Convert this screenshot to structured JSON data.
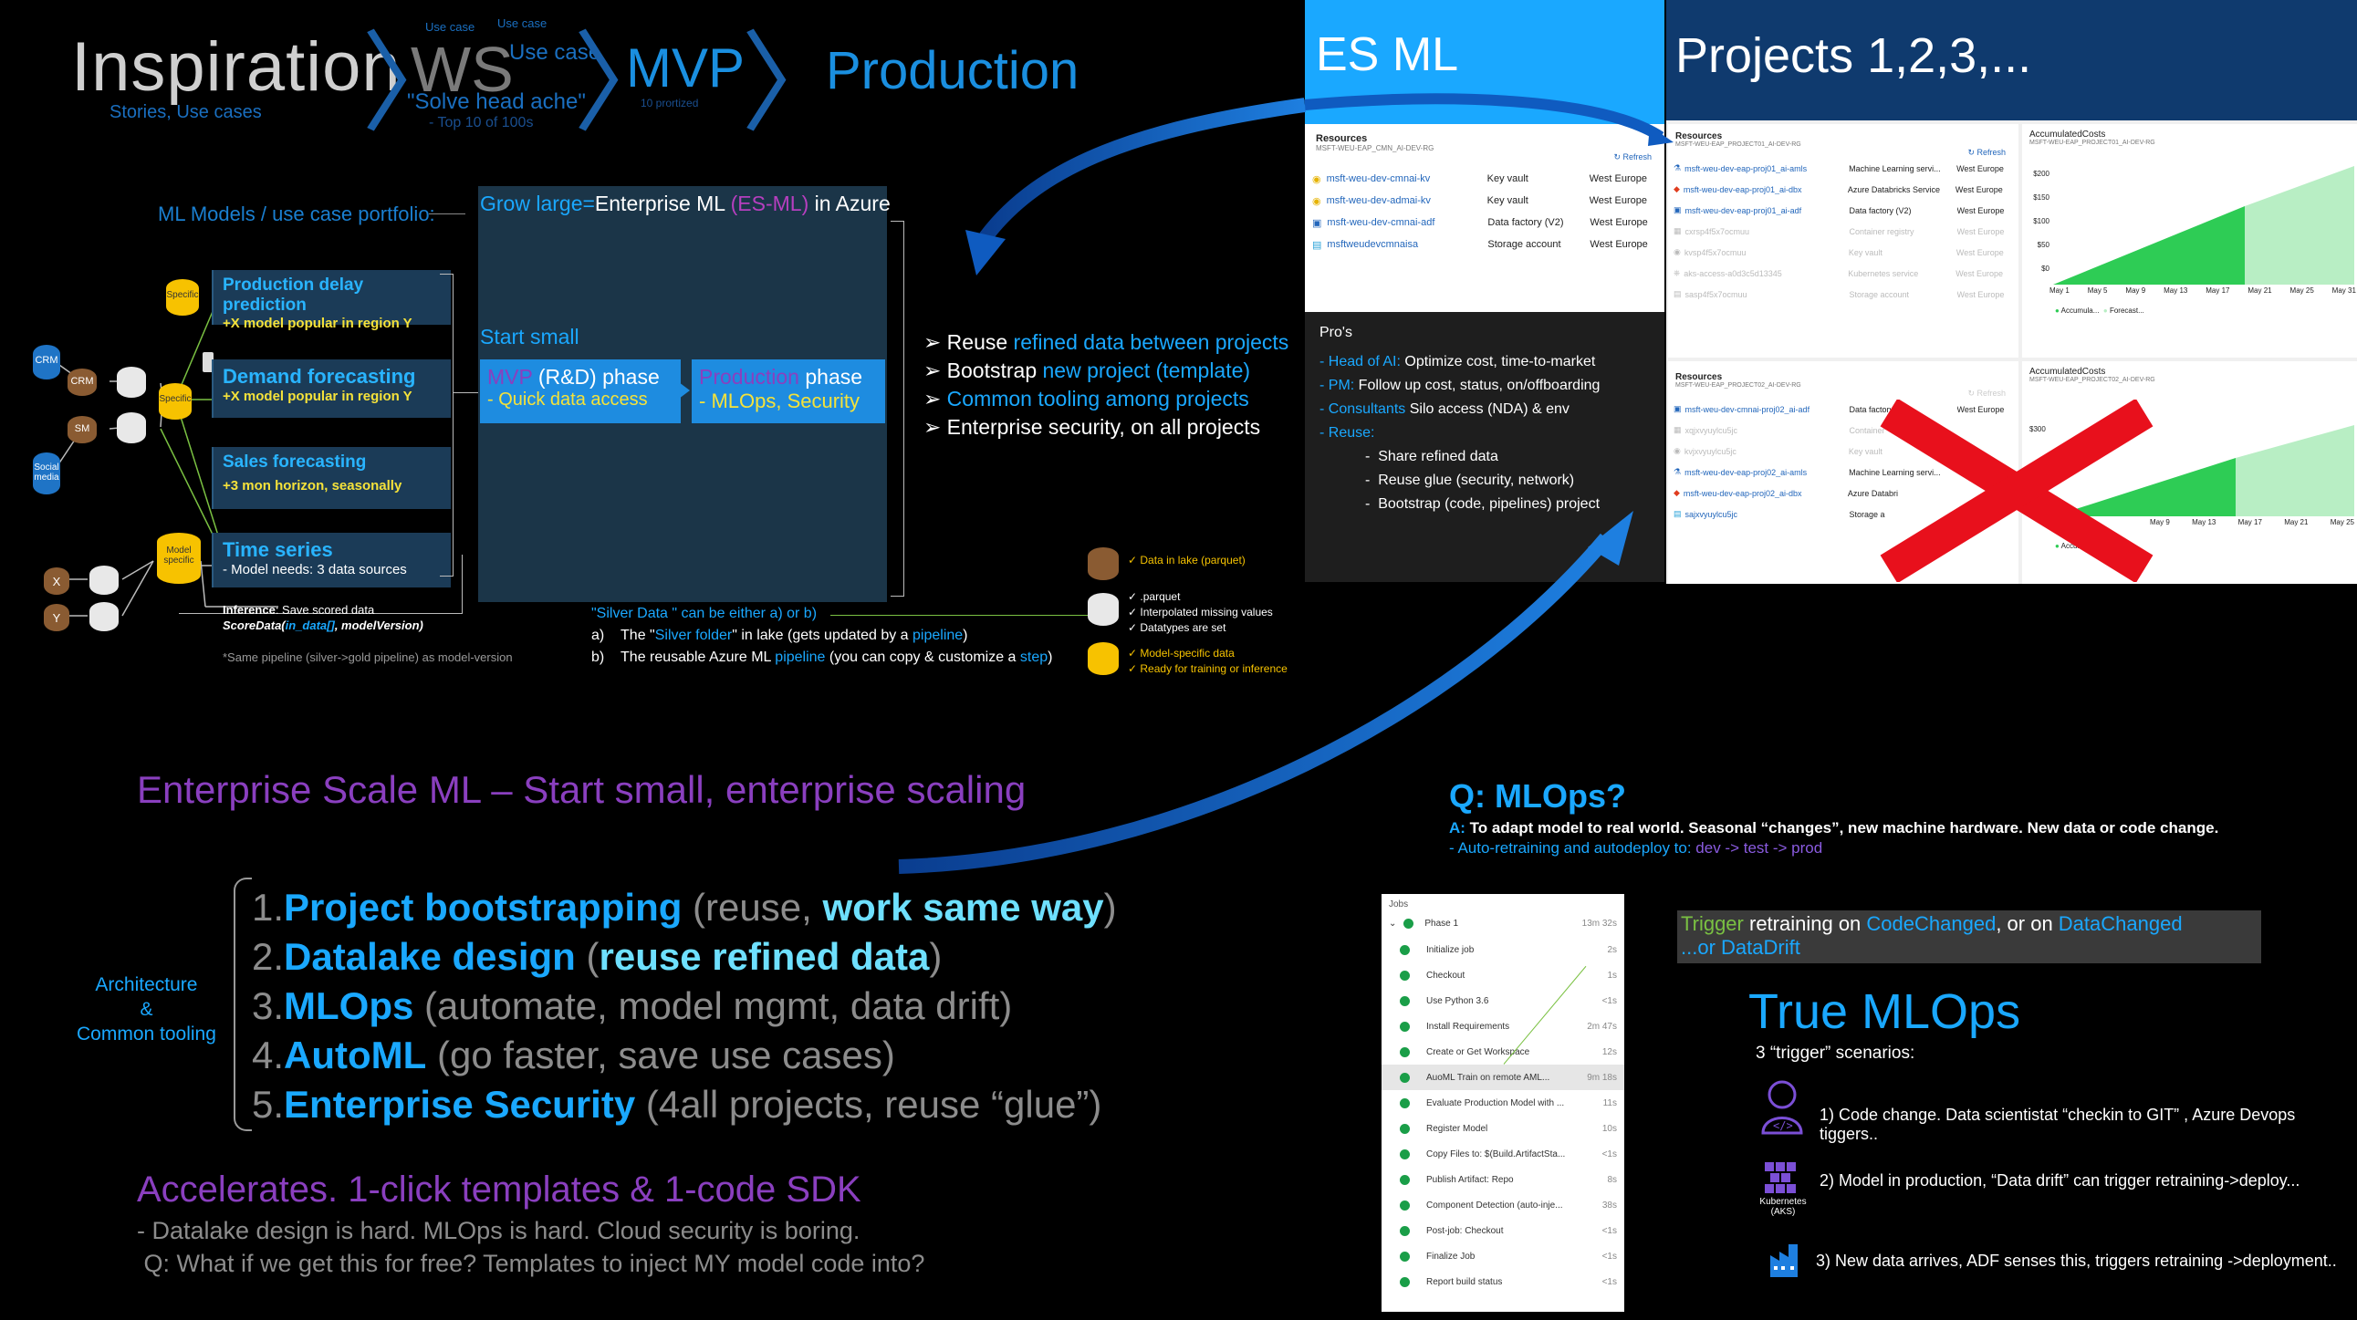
{
  "header": {
    "inspiration": "Inspiration",
    "inspiration_sub": "Stories, Use cases",
    "ws": "WS",
    "ws_usecase_small": "Use case",
    "ws_usecase_small2": "Use case",
    "ws_usecase": "Use case",
    "ws_quote": "\"Solve head ache\"",
    "ws_top": "- Top 10 of 100s",
    "mvp": "MVP",
    "mvp_sub": "10 prortized",
    "production": "Production"
  },
  "left_diagram": {
    "portfolio_title": "ML Models / use case portfolio:",
    "sources": [
      "CRM",
      "SM",
      "Social media",
      "X",
      "Y"
    ],
    "node_crm": "CRM",
    "node_sm": "SM",
    "specific": "Specific",
    "model_specific": "Model specific",
    "models": [
      {
        "title": "Production delay prediction",
        "sub": "+X model popular in region Y"
      },
      {
        "title": "Demand forecasting",
        "sub": "+X model popular in region Y"
      },
      {
        "title": "Sales forecasting",
        "sub": "+3 mon horizon, seasonally"
      },
      {
        "title": "Time series",
        "sub": "- Model needs: 3 data sources"
      }
    ],
    "inference_label": "Inference",
    "inference_text": ": Save scored data",
    "score_fn": "ScoreData(",
    "score_arg1": "in_data[]",
    "score_arg2": ", modelVersion)",
    "same_pipeline": "*Same pipeline (silver->gold pipeline) as model-version"
  },
  "center_box": {
    "grow_prefix": "Grow large=",
    "grow_mid": "Enterprise ML ",
    "grow_esml": "(ES-ML)",
    "grow_suffix": " in Azure",
    "start_small": "Start small",
    "mvp_phase_a": "MVP",
    "mvp_phase_b": " (R&D) phase",
    "mvp_sub": "- Quick data access",
    "prod_phase_a": "Production",
    "prod_phase_b": " phase",
    "prod_sub_a": "- MLOps, ",
    "prod_sub_b": "Security"
  },
  "bullets": [
    {
      "a": "Reuse ",
      "b": "refined data",
      "c": " between projects"
    },
    {
      "a": "Bootstrap ",
      "b": "new project (template)",
      "c": ""
    },
    {
      "a": "",
      "b": "Common tooling among projects",
      "c": ""
    },
    {
      "a": "Enterprise security, on all projects",
      "b": "",
      "c": ""
    }
  ],
  "silver": {
    "title": "\"Silver Data \" can be either a) or b)",
    "a_label": "a)",
    "a_text1": "The \"",
    "a_link": "Silver folder",
    "a_text2": "\" in lake (gets updated by a ",
    "a_link2": "pipeline",
    "a_text3": ")",
    "b_label": "b)",
    "b_text1": "The reusable Azure ML ",
    "b_link": "pipeline",
    "b_text2": " (you can copy & customize a ",
    "b_link2": "step",
    "b_text3": ")"
  },
  "legend": {
    "brown": "Data in lake (parquet)",
    "white": [
      ".parquet",
      "Interpolated missing values",
      "Datatypes are set"
    ],
    "yellow": [
      "Model-specific data",
      "Ready for training or inference"
    ]
  },
  "esml_panel": {
    "title": "ES ML",
    "resources_title": "Resources",
    "resources_sub": "MSFT-WEU-EAP_CMN_AI-DEV-RG",
    "refresh": "Refresh",
    "rows": [
      {
        "name": "msft-weu-dev-cmnai-kv",
        "type": "Key vault",
        "loc": "West Europe"
      },
      {
        "name": "msft-weu-dev-admai-kv",
        "type": "Key vault",
        "loc": "West Europe"
      },
      {
        "name": "msft-weu-dev-cmnai-adf",
        "type": "Data factory (V2)",
        "loc": "West Europe"
      },
      {
        "name": "msftweudevcmnaisa",
        "type": "Storage account",
        "loc": "West Europe"
      }
    ],
    "pros_title": "Pro's",
    "pros": [
      {
        "label": "Head of AI:",
        "text": " Optimize cost, time-to-market"
      },
      {
        "label": "PM:",
        "text": " Follow up cost, status, on/offboarding"
      },
      {
        "label": "Consultants",
        "text": "  Silo access (NDA) & env"
      },
      {
        "label": "Reuse:",
        "text": ""
      }
    ],
    "reuse_items": [
      "Share refined data",
      "Reuse glue (security, network)",
      "Bootstrap (code, pipelines) project"
    ]
  },
  "projects_panel": {
    "title": "Projects 1,2,3,...",
    "p1_resources": "Resources",
    "p1_sub": "MSFT-WEU-EAP_PROJECT01_AI-DEV-RG",
    "p1_rows": [
      {
        "name": "msft-weu-dev-eap-proj01_ai-amls",
        "type": "Machine Learning servi...",
        "loc": "West Europe"
      },
      {
        "name": "msft-weu-dev-eap-proj01_ai-dbx",
        "type": "Azure Databricks Service",
        "loc": "West Europe"
      },
      {
        "name": "msft-weu-dev-eap-proj01_ai-adf",
        "type": "Data factory (V2)",
        "loc": "West Europe"
      },
      {
        "name": "cxrsp4f5x7ocmuu",
        "type": "Container registry",
        "loc": "West Europe"
      },
      {
        "name": "kvsp4f5x7ocmuu",
        "type": "Key vault",
        "loc": "West Europe"
      },
      {
        "name": "aks-access-a0d3c5d13345",
        "type": "Kubernetes service",
        "loc": "West Europe"
      },
      {
        "name": "sasp4f5x7ocmuu",
        "type": "Storage account",
        "loc": "West Europe"
      }
    ],
    "p2_resources": "Resources",
    "p2_sub": "MSFT-WEU-EAP_PROJECT02_AI-DEV-RG",
    "p2_rows": [
      {
        "name": "msft-weu-dev-cmnai-proj02_ai-adf",
        "type": "Data factory (V2)",
        "loc": "West Europe"
      },
      {
        "name": "xqjxvyuylcu5jc",
        "type": "Container",
        "loc": ""
      },
      {
        "name": "kvjxvyuylcu5jc",
        "type": "Key vault",
        "loc": ""
      },
      {
        "name": "msft-weu-dev-eap-proj02_ai-amls",
        "type": "Machine Learning servi...",
        "loc": ""
      },
      {
        "name": "msft-weu-dev-eap-proj02_ai-dbx",
        "type": "Azure Databri",
        "loc": ""
      },
      {
        "name": "sajxvyuylcu5jc",
        "type": "Storage a",
        "loc": "Europe"
      }
    ],
    "cost1_title": "AccumulatedCosts",
    "cost1_sub": "MSFT-WEU-EAP_PROJECT01_AI-DEV-RG",
    "cost1_yticks": [
      "$200",
      "$150",
      "$100",
      "$50",
      "$0"
    ],
    "cost1_xticks": [
      "May 1",
      "May 5",
      "May 9",
      "May 13",
      "May 17",
      "May 21",
      "May 25",
      "May 31"
    ],
    "cost1_legend": [
      "Accumula...",
      "Forecast..."
    ],
    "cost2_title": "AccumulatedCosts",
    "cost2_sub": "MSFT-WEU-EAP_PROJECT02_AI-DEV-RG",
    "cost2_yticks": [
      "$300"
    ],
    "cost2_xticks": [
      "May 9",
      "May 13",
      "May 17",
      "May 21",
      "May 25"
    ],
    "cost2_legend": [
      "Accumula..."
    ]
  },
  "esml_heading": "Enterprise Scale ML – Start small, enterprise scaling",
  "arch_label": [
    "Architecture",
    "&",
    "Common tooling"
  ],
  "list": [
    {
      "num": "1.",
      "hl": "Project bootstrapping",
      "rest1": " (reuse, ",
      "hl2": "work same way",
      "rest2": ")"
    },
    {
      "num": "2.",
      "hl": "Datalake design",
      "rest1": " (",
      "hl2": "reuse refined data",
      "rest2": ")"
    },
    {
      "num": "3.",
      "hl": "MLOps",
      "rest1": " (automate, model mgmt, data drift)",
      "hl2": "",
      "rest2": ""
    },
    {
      "num": "4.",
      "hl": "AutoML",
      "rest1": " (go faster, save use cases)",
      "hl2": "",
      "rest2": ""
    },
    {
      "num": "5.",
      "hl": "Enterprise Security",
      "rest1": " (4all projects, reuse “glue”)",
      "hl2": "",
      "rest2": ""
    }
  ],
  "accel": {
    "title": "Accelerates. 1-click templates & 1-code SDK",
    "line1": "- Datalake design is hard. MLOps is hard. Cloud security is boring.",
    "line2": " Q: What if we get this for free? Templates to inject MY model code into?"
  },
  "mlops": {
    "q": "Q: MLOps?",
    "a_label": "A:",
    "a_text": " To adapt model to real world. Seasonal “changes”, new machine hardware. New data or code change.",
    "auto_prefix": "-  Auto-retraining and autodeploy to: ",
    "auto_envs": "dev -> test  -> prod",
    "trigger_a": "Trigger",
    "trigger_b": " retraining on ",
    "trigger_c": "CodeChanged",
    "trigger_d": ", or on ",
    "trigger_e": "DataChanged",
    "trigger_f": "...or DataDrift",
    "true_mlops": "True MLOps",
    "scenarios_title": "3 “trigger” scenarios:",
    "scenarios": [
      "1) Code change. Data scientistat  “checkin to GIT” , Azure Devops tiggers..",
      "2)  Model in production, “Data drift” can trigger retraining->deploy...",
      "3) New data arrives, ADF senses this, triggers retraining ->deployment.."
    ],
    "k8s_label": "Kubernetes (AKS)"
  },
  "jobs": {
    "title": "Jobs",
    "phase": "Phase 1",
    "phase_time": "13m 32s",
    "rows": [
      {
        "name": "Initialize job",
        "time": "2s"
      },
      {
        "name": "Checkout",
        "time": "1s"
      },
      {
        "name": "Use Python 3.6",
        "time": "<1s"
      },
      {
        "name": "Install Requirements",
        "time": "2m 47s"
      },
      {
        "name": "Create or Get Workspace",
        "time": "12s"
      },
      {
        "name": "AuoML Train on remote AML...",
        "time": "9m 18s"
      },
      {
        "name": "Evaluate Production Model with ...",
        "time": "11s"
      },
      {
        "name": "Register Model",
        "time": "10s"
      },
      {
        "name": "Copy Files to: $(Build.ArtifactSta...",
        "time": "<1s"
      },
      {
        "name": "Publish Artifact: Repo",
        "time": "8s"
      },
      {
        "name": "Component Detection (auto-inje...",
        "time": "38s"
      },
      {
        "name": "Post-job: Checkout",
        "time": "<1s"
      },
      {
        "name": "Finalize Job",
        "time": "<1s"
      },
      {
        "name": "Report build status",
        "time": "<1s"
      }
    ]
  },
  "colors": {
    "accent_blue": "#1aa8ff",
    "purple": "#8a3fbf",
    "yellow": "#f5e23a",
    "green_cost": "#2ecc55",
    "red_x": "#e8101c"
  }
}
